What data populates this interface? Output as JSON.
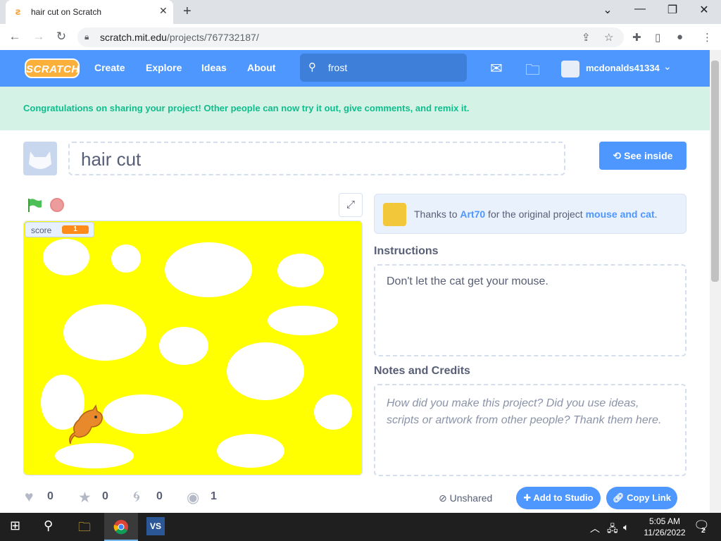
{
  "browser": {
    "tab_title": "hair cut on Scratch",
    "url_host": "scratch.mit.edu",
    "url_path": "/projects/767732187/"
  },
  "nav": {
    "logo": "SCRATCH",
    "links": [
      "Create",
      "Explore",
      "Ideas",
      "About"
    ],
    "search_value": "frost",
    "username": "mcdonalds41334"
  },
  "banner": {
    "message": "Congratulations on sharing your project! Other people can now try it out, give comments, and remix it."
  },
  "project": {
    "title": "hair cut",
    "see_inside_label": "See inside",
    "score_label": "score",
    "score_value": "1"
  },
  "credits": {
    "prefix": "Thanks to ",
    "author": "Art70",
    "middle": " for the original project ",
    "original_project": "mouse and cat",
    "suffix": "."
  },
  "instructions": {
    "heading": "Instructions",
    "text": "Don't let the cat get your mouse."
  },
  "notes": {
    "heading": "Notes and Credits",
    "placeholder": "How did you make this project? Did you use ideas, scripts or artwork from other people? Thank them here."
  },
  "stats": {
    "loves": "0",
    "favorites": "0",
    "remixes": "0",
    "views": "1"
  },
  "actions": {
    "unshared": "Unshared",
    "add_to_studio": "Add to Studio",
    "copy_link": "Copy Link"
  },
  "taskbar": {
    "time": "5:05 AM",
    "date": "11/26/2022",
    "notif_count": "2"
  },
  "colors": {
    "scratch_blue": "#4d97ff",
    "stage_yellow": "#ffff00",
    "banner_green": "#0fbd8c"
  }
}
